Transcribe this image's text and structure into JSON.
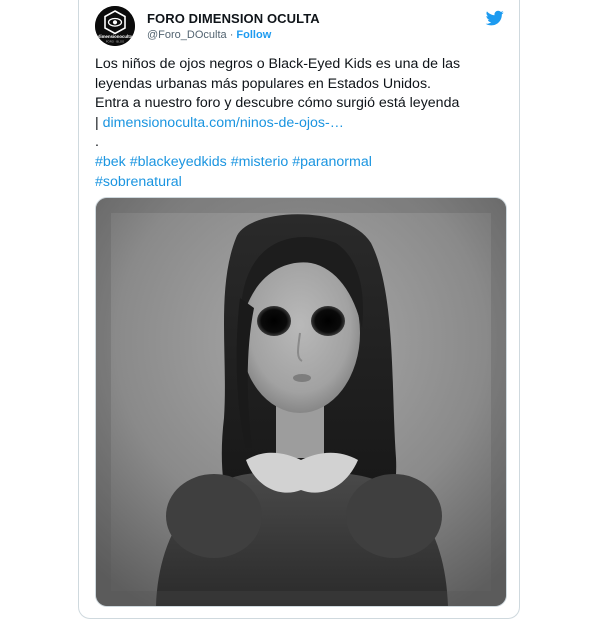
{
  "account": {
    "display_name": "FORO DIMENSION OCULTA",
    "handle": "@Foro_DOculta",
    "separator": " · ",
    "follow_label": "Follow",
    "avatar_text": "dimensionoculta",
    "avatar_subtext": "FORO · BLOG"
  },
  "tweet": {
    "line1": "Los niños de ojos negros o Black-Eyed Kids es una de las",
    "line2": "leyendas urbanas más populares en Estados Unidos.",
    "line3": "Entra a nuestro foro y descubre cómo surgió está leyenda",
    "line4_prefix": "| ",
    "link": "dimensionoculta.com/ninos-de-ojos-…",
    "dot": ".",
    "hashtags": [
      "#bek",
      "#blackeyedkids",
      "#misterio",
      "#paranormal",
      "#sobrenatural"
    ]
  },
  "icons": {
    "platform": "twitter-bird-icon",
    "brand_color": "#1d9bf0",
    "link_color": "#1b95e0"
  }
}
